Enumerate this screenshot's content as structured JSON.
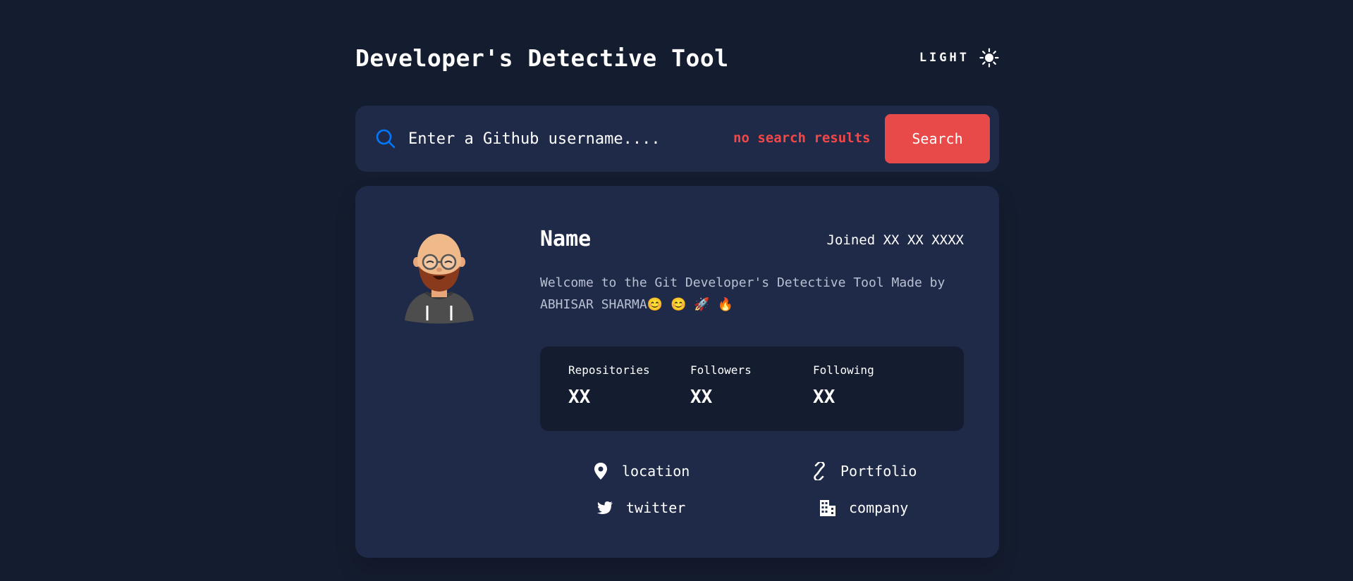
{
  "header": {
    "title": "Developer's Detective Tool",
    "theme_label": "LIGHT",
    "theme_icon": "sun-icon"
  },
  "search": {
    "placeholder": "Enter a Github username....",
    "value": "",
    "status": "no search results",
    "button_label": "Search",
    "icon": "search-icon"
  },
  "profile": {
    "name": "Name",
    "joined": "Joined XX XX XXXX",
    "bio": "Welcome to the Git Developer's Detective Tool Made by ABHISAR SHARMA😊 😊 🚀 🔥",
    "avatar": "avatar-icon",
    "stats": [
      {
        "label": "Repositories",
        "value": "XX"
      },
      {
        "label": "Followers",
        "value": "XX"
      },
      {
        "label": "Following",
        "value": "XX"
      }
    ],
    "links": {
      "location": {
        "label": "location",
        "icon": "location-pin-icon"
      },
      "portfolio": {
        "label": "Portfolio",
        "icon": "link-icon"
      },
      "twitter": {
        "label": "twitter",
        "icon": "twitter-icon"
      },
      "company": {
        "label": "company",
        "icon": "building-icon"
      }
    }
  },
  "colors": {
    "background": "#141c2f",
    "card": "#1f2a48",
    "accent_red": "#e84a4a",
    "error_text": "#f74646",
    "search_icon_blue": "#0079ff"
  }
}
